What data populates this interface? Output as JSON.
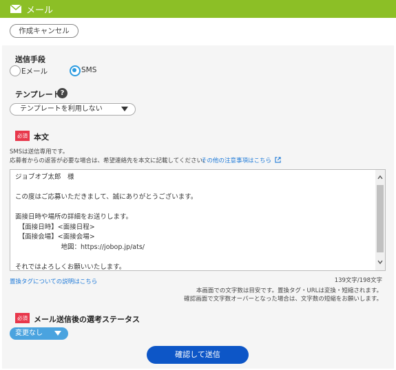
{
  "header": {
    "title": "メール",
    "icon": "envelope-icon"
  },
  "cancel_button": "作成キャンセル",
  "send_method": {
    "label": "送信手段",
    "options": [
      {
        "label": "Eメール",
        "selected": false
      },
      {
        "label": "SMS",
        "selected": true
      }
    ]
  },
  "template": {
    "label": "テンプレート",
    "help": "?",
    "select_value": "テンプレートを利用しない"
  },
  "body_section": {
    "required": "必須",
    "label": "本文",
    "note1": "SMSは送信専用です。",
    "note2": "応募者からの返答が必要な場合は、希望連絡先を本文に記載してください。",
    "caution_link": "その他の注意事項はこちら",
    "text_lines": [
      "ジョブオブ太郎　様",
      "",
      "この度はご応募いただきまして、誠にありがとうございます。",
      "",
      "面接日時や場所の詳細をお送りします。",
      "　【面接日時】<面接日程>",
      "　【面接会場】<面接会場>",
      "　　　　　　　地図：https://jobop.jp/ats/",
      "",
      "それではよろしくお願いいたします。"
    ],
    "tag_link": "置換タグについての説明はこちら",
    "char_count": "139文字/198文字",
    "count_note1": "本画面での文字数は目安です。置換タグ・URLは変換・短縮されます。",
    "count_note2": "確認画面で文字数オーバーとなった場合は、文字数の短縮をお願いします。"
  },
  "status_section": {
    "required": "必須",
    "label": "メール送信後の選考ステータス",
    "select_value": "変更なし"
  },
  "submit_button": "確認して送信"
}
